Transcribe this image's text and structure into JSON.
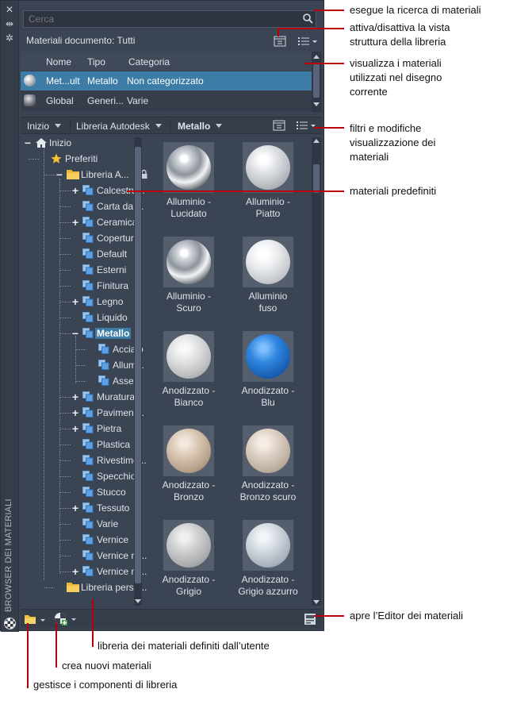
{
  "palette": {
    "title": "BROWSER DEI MATERIALI",
    "search": {
      "placeholder": "Cerca"
    },
    "document_materials_label": "Materiali documento: Tutti",
    "table": {
      "columns": [
        "Nome",
        "Tipo",
        "Categoria"
      ],
      "rows": [
        {
          "name": "Met...ult",
          "type": "Metallo",
          "category": "Non categorizzato",
          "selected": true
        },
        {
          "name": "Global",
          "type": "Generi...",
          "category": "Varie",
          "selected": false
        }
      ]
    },
    "library_bar": {
      "items": [
        "Inizio",
        "Libreria Autodesk",
        "Metallo"
      ]
    },
    "tree": [
      {
        "label": "Inizio",
        "icon": "home-icon",
        "expander": "−"
      },
      {
        "label": "Preferiti",
        "icon": "star-icon",
        "expander": ""
      },
      {
        "label": "Libreria A...",
        "icon": "folder-icon",
        "expander": "−",
        "locked": true
      },
      {
        "label": "Calcestru...",
        "icon": "category-icon",
        "expander": "+"
      },
      {
        "label": "Carta da ...",
        "icon": "category-icon",
        "expander": ""
      },
      {
        "label": "Ceramica",
        "icon": "category-icon",
        "expander": "+"
      },
      {
        "label": "Copertura",
        "icon": "category-icon",
        "expander": ""
      },
      {
        "label": "Default",
        "icon": "category-icon",
        "expander": ""
      },
      {
        "label": "Esterni",
        "icon": "category-icon",
        "expander": ""
      },
      {
        "label": "Finitura",
        "icon": "category-icon",
        "expander": ""
      },
      {
        "label": "Legno",
        "icon": "category-icon",
        "expander": "+"
      },
      {
        "label": "Liquido",
        "icon": "category-icon",
        "expander": ""
      },
      {
        "label": "Metallo",
        "icon": "category-icon",
        "expander": "−",
        "selected": true
      },
      {
        "label": "Acciaio",
        "icon": "category-icon",
        "expander": ""
      },
      {
        "label": "Allum...",
        "icon": "category-icon",
        "expander": ""
      },
      {
        "label": "Asse...",
        "icon": "category-icon",
        "expander": ""
      },
      {
        "label": "Muratura",
        "icon": "category-icon",
        "expander": "+"
      },
      {
        "label": "Paviment...",
        "icon": "category-icon",
        "expander": "+"
      },
      {
        "label": "Pietra",
        "icon": "category-icon",
        "expander": "+"
      },
      {
        "label": "Plastica",
        "icon": "category-icon",
        "expander": ""
      },
      {
        "label": "Rivestime...",
        "icon": "category-icon",
        "expander": ""
      },
      {
        "label": "Specchio",
        "icon": "category-icon",
        "expander": ""
      },
      {
        "label": "Stucco",
        "icon": "category-icon",
        "expander": ""
      },
      {
        "label": "Tessuto",
        "icon": "category-icon",
        "expander": "+"
      },
      {
        "label": "Varie",
        "icon": "category-icon",
        "expander": ""
      },
      {
        "label": "Vernice",
        "icon": "category-icon",
        "expander": ""
      },
      {
        "label": "Vernice m...",
        "icon": "category-icon",
        "expander": ""
      },
      {
        "label": "Vernice m...",
        "icon": "category-icon",
        "expander": "+"
      },
      {
        "label": "Libreria perso...",
        "icon": "folder-icon",
        "expander": ""
      }
    ],
    "materials": [
      {
        "name": "Alluminio -\nLucidato",
        "finish": "chrome"
      },
      {
        "name": "Alluminio -\nPiatto",
        "finish": "satin"
      },
      {
        "name": "Alluminio -\nScuro",
        "finish": "chrome"
      },
      {
        "name": "Alluminio\nfuso",
        "finish": "matte"
      },
      {
        "name": "Anodizzato -\nBianco",
        "finish": "white"
      },
      {
        "name": "Anodizzato -\nBlu",
        "finish": "blue"
      },
      {
        "name": "Anodizzato -\nBronzo",
        "finish": "bronze"
      },
      {
        "name": "Anodizzato -\nBronzo scuro",
        "finish": "bronze-light"
      },
      {
        "name": "Anodizzato -\nGrigio",
        "finish": "grey"
      },
      {
        "name": "Anodizzato -\nGrigio azzurro",
        "finish": "blue-grey"
      }
    ]
  },
  "callouts": {
    "search": "esegue la ricerca di materiali",
    "tree_toggle": "attiva/disattiva la vista\nstruttura della libreria",
    "document_materials": "visualizza i materiali\nutilizzati nel disegno\ncorrente",
    "filters": "filtri e modifiche\nvisualizzazione dei\nmateriali",
    "predefined": "materiali predefiniti",
    "editor": "apre l’Editor dei materiali",
    "user_library": "libreria dei materiali definiti dall’utente",
    "create_new": "crea nuovi materiali",
    "manage_library": "gestisce i componenti di libreria"
  },
  "colors": {
    "panel": "#3b4453",
    "selection": "#3c7ca7",
    "callout_line": "#b8000a"
  }
}
